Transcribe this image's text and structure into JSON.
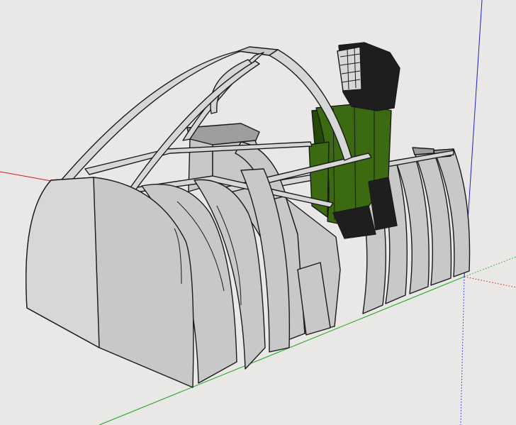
{
  "viewport": {
    "background": "#e9e8e6"
  },
  "axes": {
    "red": "#cc1f1f",
    "green": "#18a418",
    "blue": "#1f1fcc"
  },
  "model": {
    "face_color": "#c8c8c8",
    "face_light": "#d7d7d7",
    "face_dark": "#9e9e9e",
    "edge_color": "#1a1a1a",
    "seat_color": "#3c6a10",
    "seat_dark": "#244a06",
    "headrest_color": "#1e1e1e"
  }
}
